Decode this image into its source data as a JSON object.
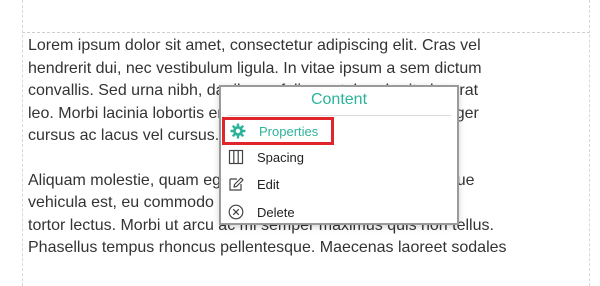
{
  "editor": {
    "paragraphs": [
      {
        "lines": [
          "Lorem ipsum dolor sit amet, consectetur adipiscing elit. Cras vel",
          "hendrerit dui, nec vestibulum ligula. In vitae ipsum a sem dictum",
          "convallis. Sed urna nibh, dapibus a felis eget, hendrerit placerat",
          "leo. Morbi lacinia lobortis erat, sit amet viverra ligula vel. Integer",
          "cursus ac lacus vel cursus."
        ]
      },
      {
        "lines": [
          "Aliquam molestie, quam eget tincidunt consequat, purus augue",
          "vehicula est, eu commodo nisi orci in ante. Pellentesque id",
          "tortor lectus. Morbi ut arcu ac mi semper maximus quis non tellus.",
          "Phasellus tempus rhoncus pellentesque. Maecenas laoreet sodales"
        ]
      }
    ]
  },
  "context_menu": {
    "title": "Content",
    "items": [
      {
        "label": "Properties",
        "icon": "gear-icon",
        "active": true
      },
      {
        "label": "Spacing",
        "icon": "columns-icon",
        "active": false
      },
      {
        "label": "Edit",
        "icon": "edit-icon",
        "active": false
      },
      {
        "label": "Delete",
        "icon": "delete-circle-x-icon",
        "active": false
      }
    ]
  },
  "colors": {
    "accent": "#2eb39b",
    "highlight_border": "#e0262b",
    "text": "#333333"
  }
}
